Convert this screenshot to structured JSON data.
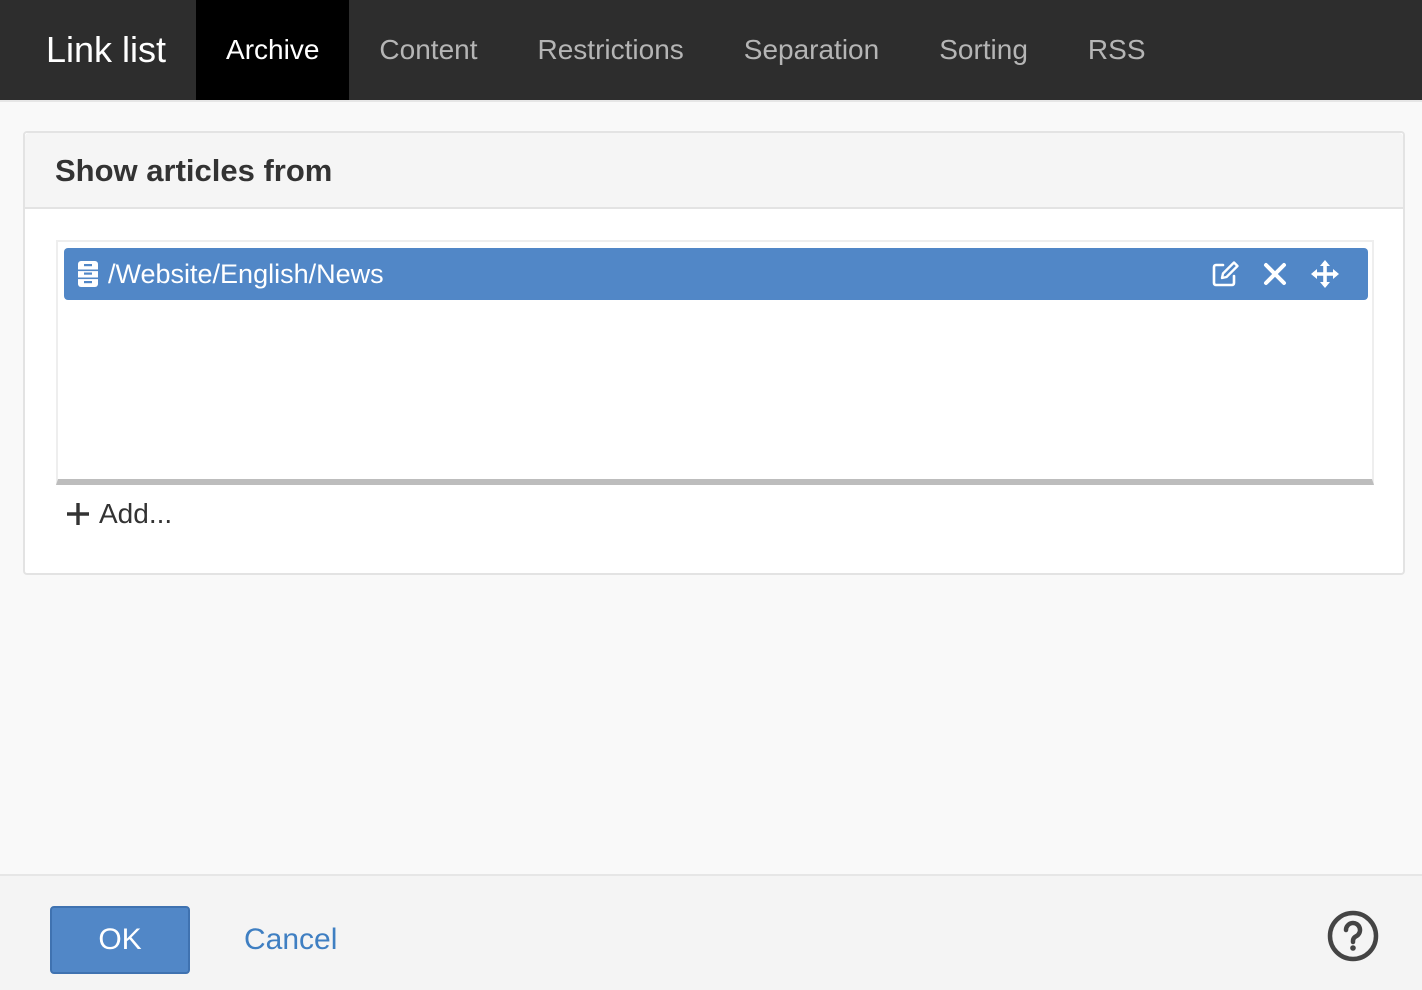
{
  "app": {
    "title": "Link list"
  },
  "tabs": [
    {
      "label": "Archive",
      "active": true
    },
    {
      "label": "Content",
      "active": false
    },
    {
      "label": "Restrictions",
      "active": false
    },
    {
      "label": "Separation",
      "active": false
    },
    {
      "label": "Sorting",
      "active": false
    },
    {
      "label": "RSS",
      "active": false
    }
  ],
  "panel": {
    "title": "Show articles from",
    "items": [
      {
        "path": "/Website/English/News",
        "icon": "archive-cabinet-icon"
      }
    ],
    "add_label": "Add..."
  },
  "footer": {
    "ok_label": "OK",
    "cancel_label": "Cancel",
    "help_icon": "help-circle-icon"
  },
  "colors": {
    "topbar": "#2d2d2d",
    "active_tab": "#000000",
    "accent": "#5187c7",
    "link": "#3f7fc2"
  }
}
